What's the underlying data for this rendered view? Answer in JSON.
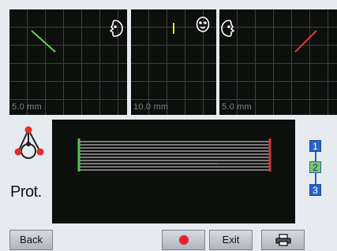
{
  "viewports": {
    "left": {
      "scale_label": "5.0 mm",
      "line_color": "#5bd84a"
    },
    "center": {
      "scale_label": "10.0 mm",
      "line_color": "#e4e024"
    },
    "right": {
      "scale_label": "5.0 mm",
      "line_color": "#e8343c"
    }
  },
  "protocol": {
    "label": "Prot."
  },
  "steps": [
    "1",
    "2",
    "3"
  ],
  "active_step": "2",
  "buttons": {
    "back": "Back",
    "exit": "Exit"
  },
  "colors": {
    "panel_bg": "#0d0f0d",
    "grid": "#3d423f",
    "start_marker": "#4fc64a",
    "end_marker": "#d2383a",
    "step_active": "#7cc66a",
    "step_inactive": "#2a64c2"
  },
  "icons": {
    "face_left": "face-profile-left-icon",
    "face_front": "face-front-icon",
    "face_right": "face-profile-right-icon",
    "record": "record-icon",
    "print": "printer-icon"
  }
}
